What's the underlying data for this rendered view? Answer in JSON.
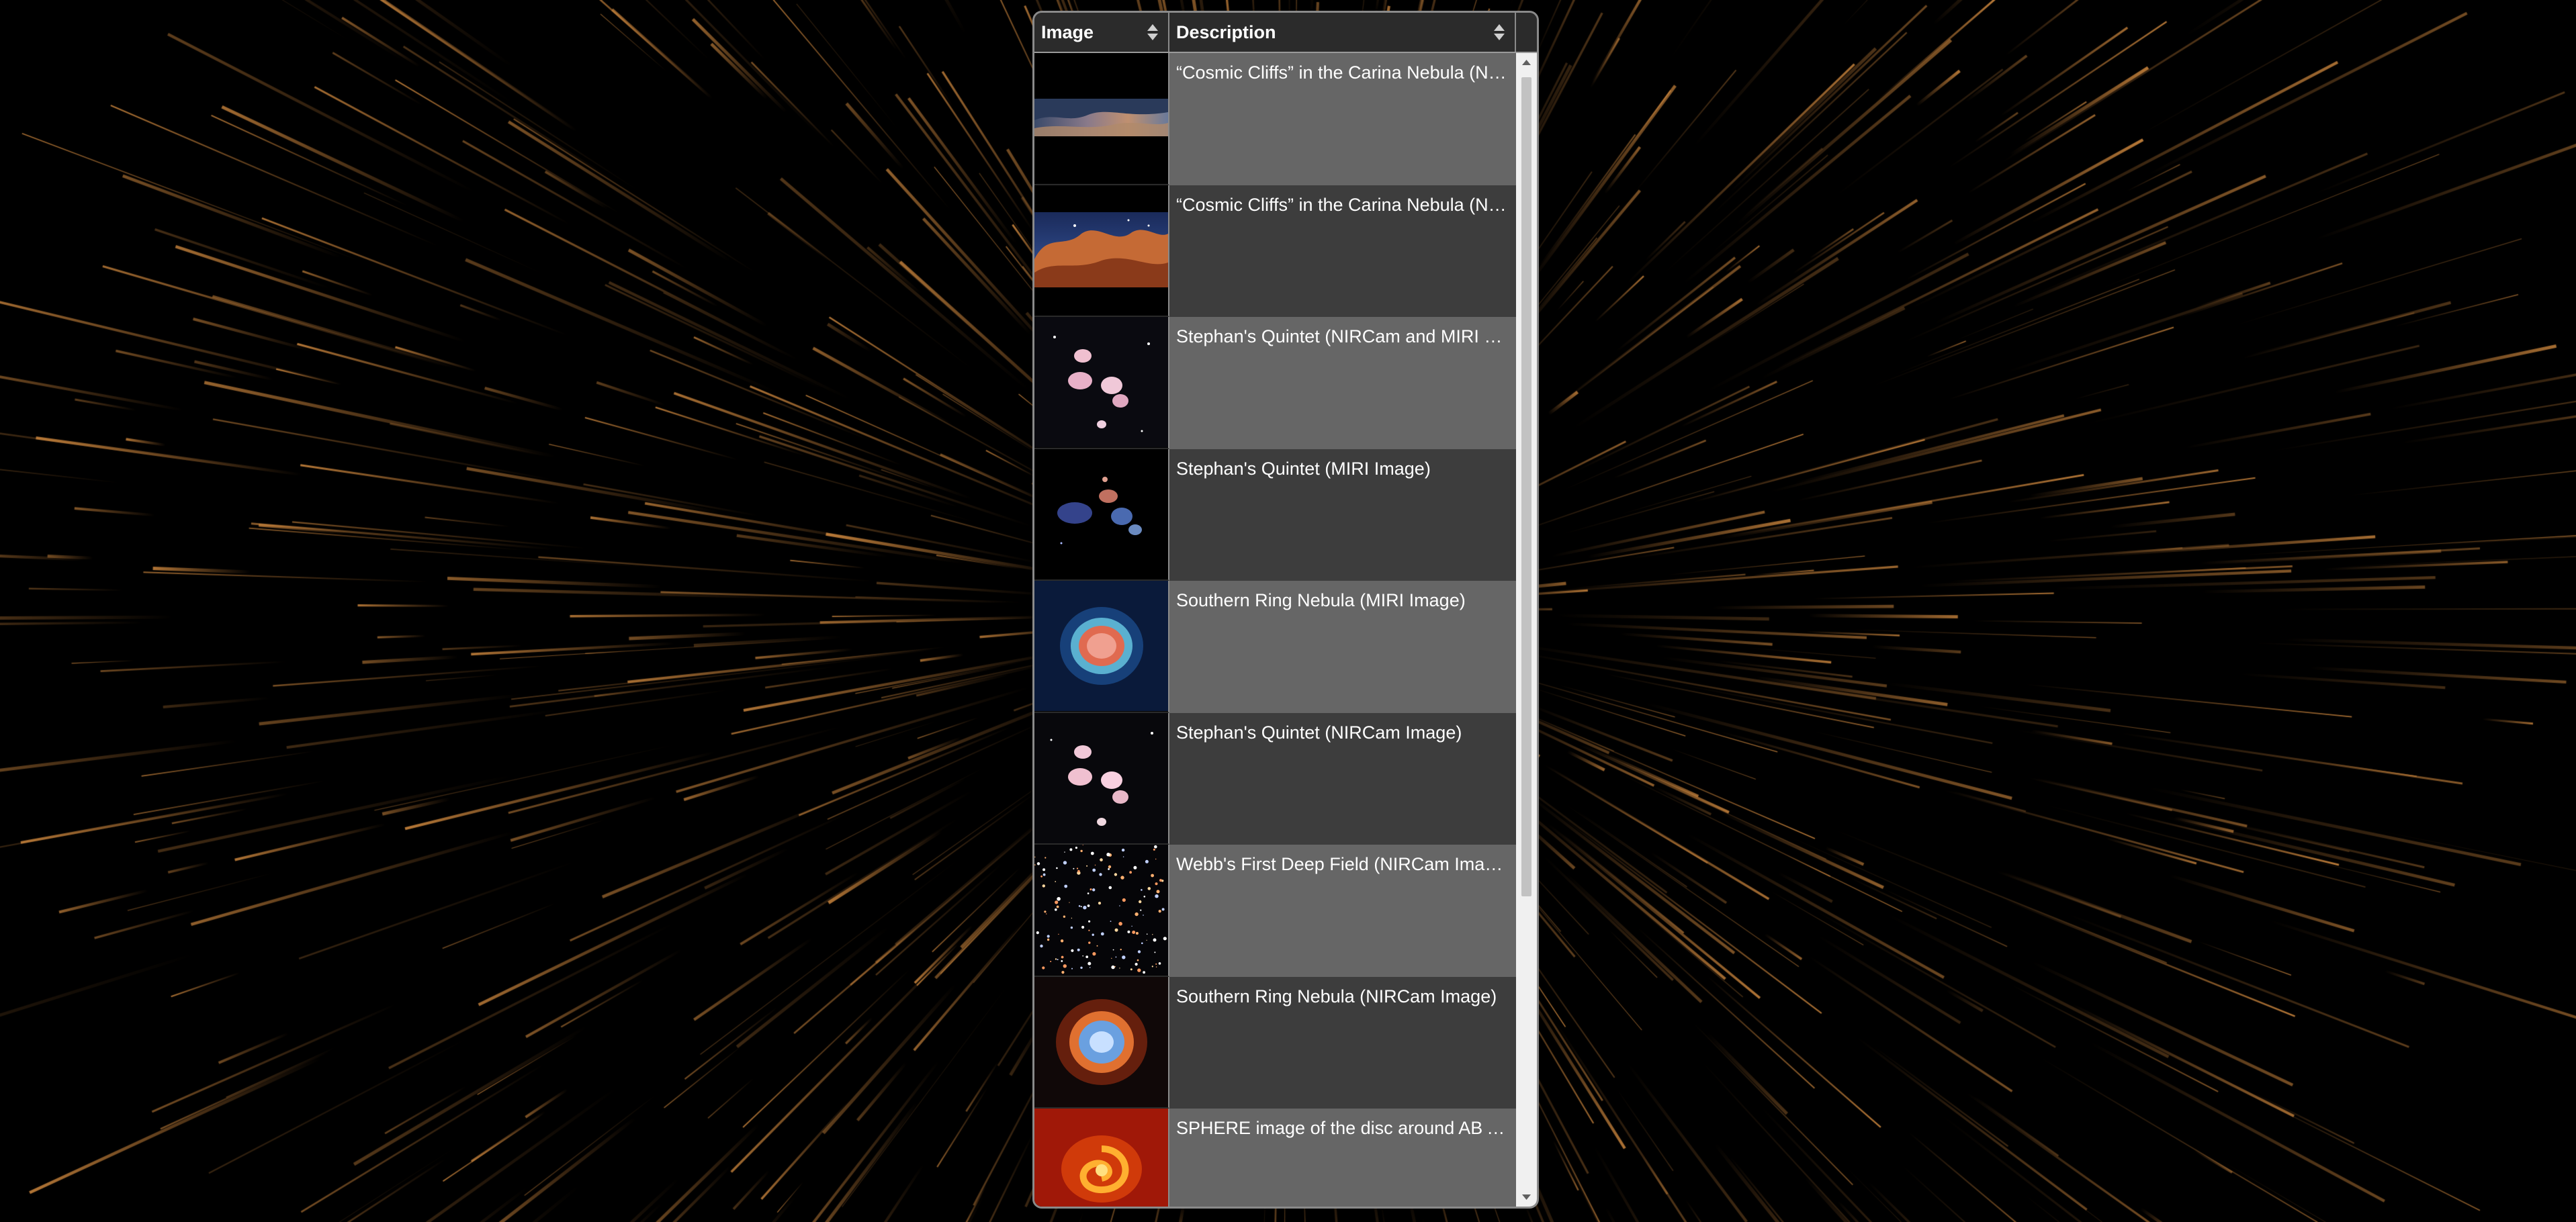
{
  "grid": {
    "columns": [
      {
        "label": "Image"
      },
      {
        "label": "Description"
      }
    ],
    "rows": [
      {
        "description": "“Cosmic Cliffs” in the Carina Nebula (NIRCam and MIRI Composite Image)",
        "thumbnail": "cosmic-cliffs-wide-thumbnail"
      },
      {
        "description": "“Cosmic Cliffs” in the Carina Nebula (NIRCam Image)",
        "thumbnail": "cosmic-cliffs-thumbnail"
      },
      {
        "description": "Stephan's Quintet (NIRCam and MIRI Composite Image)",
        "thumbnail": "stephans-quintet-composite-thumbnail"
      },
      {
        "description": "Stephan's Quintet (MIRI Image)",
        "thumbnail": "stephans-quintet-miri-thumbnail"
      },
      {
        "description": "Southern Ring Nebula (MIRI Image)",
        "thumbnail": "southern-ring-miri-thumbnail"
      },
      {
        "description": "Stephan's Quintet (NIRCam Image)",
        "thumbnail": "stephans-quintet-nircam-thumbnail"
      },
      {
        "description": "Webb's First Deep Field (NIRCam Image)",
        "thumbnail": "deep-field-thumbnail"
      },
      {
        "description": "Southern Ring Nebula (NIRCam Image)",
        "thumbnail": "southern-ring-nircam-thumbnail"
      },
      {
        "description": "SPHERE image of the disc around AB Aurigae",
        "thumbnail": "sphere-disc-thumbnail"
      }
    ]
  },
  "icons": {
    "sort": "sort-arrows-icon",
    "scroll_up": "chevron-up-icon",
    "scroll_down": "chevron-down-icon"
  },
  "colors": {
    "header_bg": "#2b2b2b",
    "row_odd_bg": "#666666",
    "row_even_bg": "#3d3d3d",
    "border": "#8a8a8a",
    "scrollbar_track": "#f0f0f0",
    "scrollbar_thumb": "#c2c2c2",
    "streak": "#c8813a"
  }
}
